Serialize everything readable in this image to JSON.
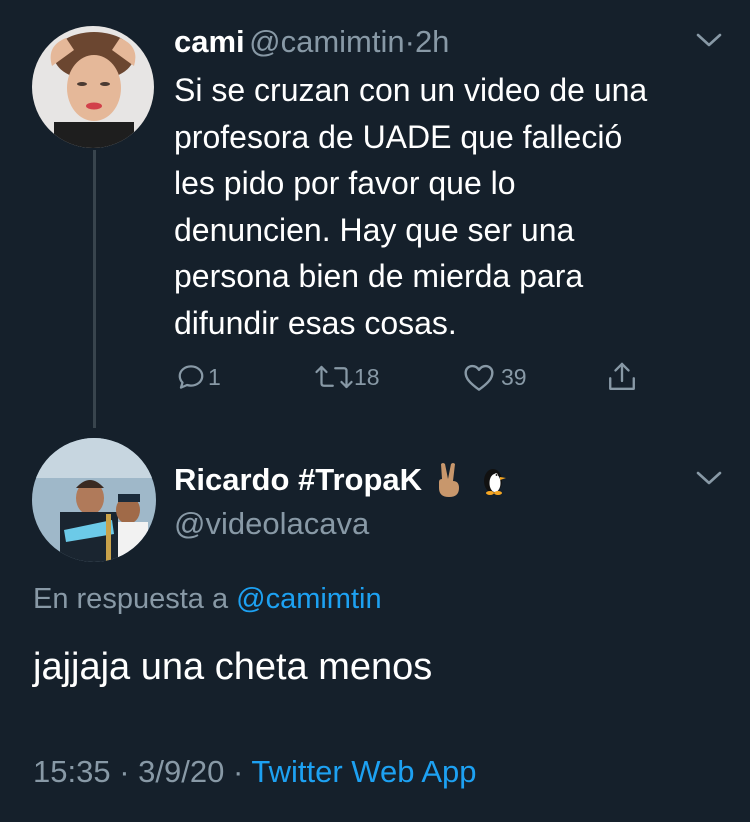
{
  "first_tweet": {
    "name": "cami",
    "handle": "@camimtin",
    "separator": "·",
    "time": "2h",
    "text_lines": [
      "Si se cruzan con un video de una",
      "profesora de UADE que falleció",
      "les pido por favor que lo",
      "denuncien. Hay que ser una",
      "persona bien de mierda para",
      "difundir esas cosas."
    ],
    "actions": {
      "replies": "1",
      "retweets": "18",
      "likes": "39"
    }
  },
  "reply_tweet": {
    "name": "Ricardo #TropaK",
    "name_emojis": [
      "victory-hand",
      "penguin"
    ],
    "handle": "@videolacava",
    "reply_prefix": "En respuesta a",
    "reply_mention": "@camimtin",
    "text": "jajjaja una cheta menos",
    "time": "15:35",
    "separator1": "·",
    "date": "3/9/20",
    "separator2": "·",
    "source": "Twitter Web App"
  },
  "colors": {
    "background": "#15202b",
    "secondary_text": "#8899a6",
    "link": "#1da1f2",
    "thread_line": "#38444d"
  }
}
